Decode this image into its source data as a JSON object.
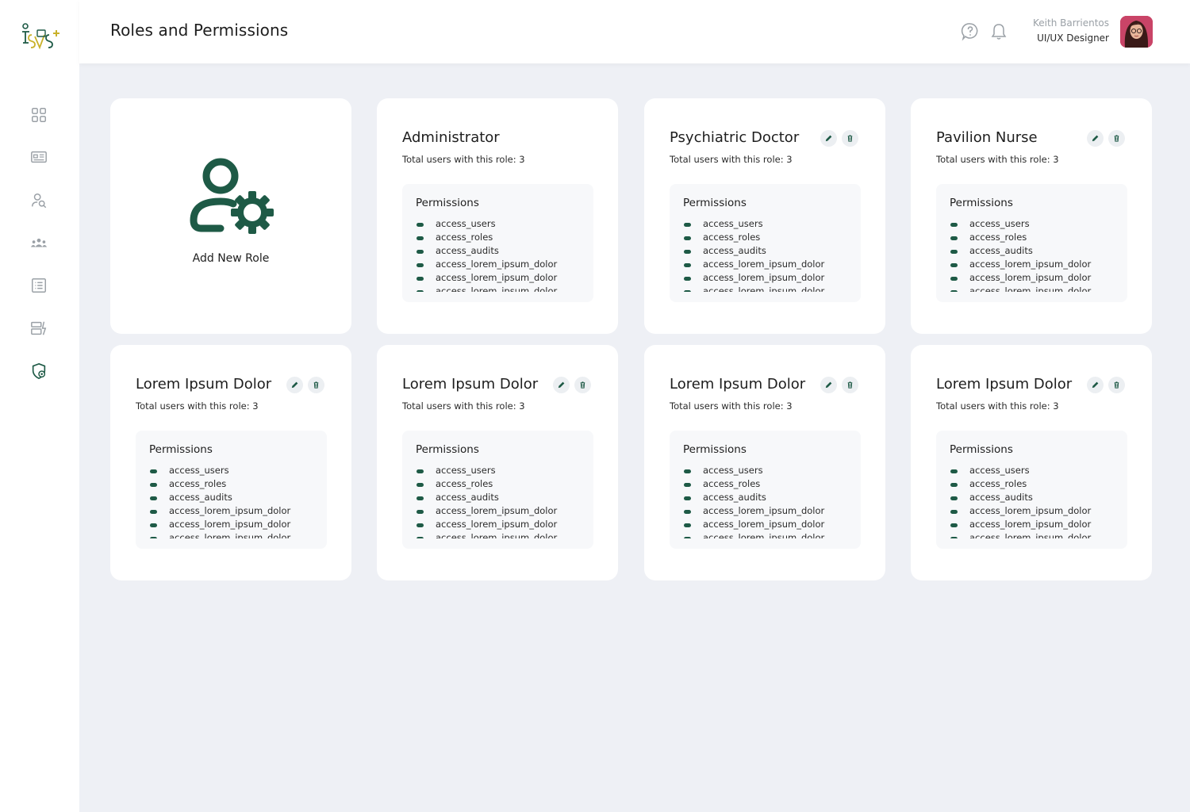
{
  "app": {
    "title": "Roles and Permissions"
  },
  "colors": {
    "accent": "#1e5a46",
    "background": "#eef0f5",
    "card": "#ffffff"
  },
  "sidebar": {
    "items": [
      {
        "icon": "dashboard-grid-icon"
      },
      {
        "icon": "id-card-icon"
      },
      {
        "icon": "user-search-icon"
      },
      {
        "icon": "users-group-icon"
      },
      {
        "icon": "list-icon"
      },
      {
        "icon": "reports-icon"
      },
      {
        "icon": "shield-settings-icon",
        "active": true
      }
    ]
  },
  "user": {
    "name": "Keith Barrientos",
    "role": "UI/UX Designer"
  },
  "add_card": {
    "label": "Add New Role"
  },
  "roles": [
    {
      "title": "Administrator",
      "subtitle": "Total users with this role: 3",
      "permissions_label": "Permissions",
      "permissions": [
        "access_users",
        "access_roles",
        "access_audits",
        "access_lorem_ipsum_dolor",
        "access_lorem_ipsum_dolor",
        "access_lorem_ipsum_dolor"
      ],
      "editable": false
    },
    {
      "title": "Psychiatric Doctor",
      "subtitle": "Total users with this role: 3",
      "permissions_label": "Permissions",
      "permissions": [
        "access_users",
        "access_roles",
        "access_audits",
        "access_lorem_ipsum_dolor",
        "access_lorem_ipsum_dolor",
        "access_lorem_ipsum_dolor"
      ],
      "editable": true
    },
    {
      "title": "Pavilion Nurse",
      "subtitle": "Total users with this role: 3",
      "permissions_label": "Permissions",
      "permissions": [
        "access_users",
        "access_roles",
        "access_audits",
        "access_lorem_ipsum_dolor",
        "access_lorem_ipsum_dolor",
        "access_lorem_ipsum_dolor"
      ],
      "editable": true
    },
    {
      "title": "Lorem Ipsum Dolor",
      "subtitle": "Total users with this role: 3",
      "permissions_label": "Permissions",
      "permissions": [
        "access_users",
        "access_roles",
        "access_audits",
        "access_lorem_ipsum_dolor",
        "access_lorem_ipsum_dolor",
        "access_lorem_ipsum_dolor"
      ],
      "editable": true
    },
    {
      "title": "Lorem Ipsum Dolor",
      "subtitle": "Total users with this role: 3",
      "permissions_label": "Permissions",
      "permissions": [
        "access_users",
        "access_roles",
        "access_audits",
        "access_lorem_ipsum_dolor",
        "access_lorem_ipsum_dolor",
        "access_lorem_ipsum_dolor"
      ],
      "editable": true
    },
    {
      "title": "Lorem Ipsum Dolor",
      "subtitle": "Total users with this role: 3",
      "permissions_label": "Permissions",
      "permissions": [
        "access_users",
        "access_roles",
        "access_audits",
        "access_lorem_ipsum_dolor",
        "access_lorem_ipsum_dolor",
        "access_lorem_ipsum_dolor"
      ],
      "editable": true
    },
    {
      "title": "Lorem Ipsum Dolor",
      "subtitle": "Total users with this role: 3",
      "permissions_label": "Permissions",
      "permissions": [
        "access_users",
        "access_roles",
        "access_audits",
        "access_lorem_ipsum_dolor",
        "access_lorem_ipsum_dolor",
        "access_lorem_ipsum_dolor"
      ],
      "editable": true
    }
  ]
}
